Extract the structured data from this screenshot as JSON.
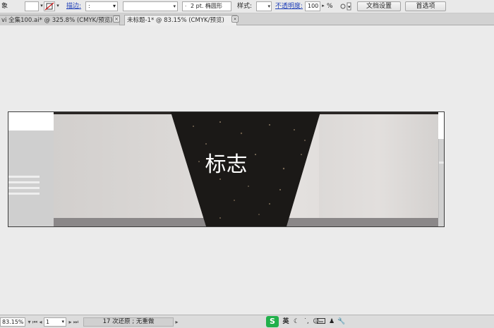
{
  "control_bar": {
    "partial_label": "象",
    "stroke_label": "描边:",
    "stroke_weight_arrow": ":",
    "brush_value": "2 pt. 椭圆形",
    "style_label": "样式:",
    "opacity_label": "不透明度:",
    "opacity_value": "100",
    "opacity_unit": "%",
    "doc_setup_button": "文档设置",
    "preferences_button": "首选项"
  },
  "tabs": [
    {
      "label": "vi 全集100.ai* @ 325.8% (CMYK/预览)",
      "active": false
    },
    {
      "label": "未标题-1* @ 83.15% (CMYK/预览)",
      "active": true
    }
  ],
  "artwork": {
    "logo_text": "标志"
  },
  "status_bar": {
    "zoom": "83.15%",
    "artboard_number": "1",
    "message": "17 次还原 ; 无重做",
    "ime_logo": "S",
    "ime_lang": "英"
  },
  "colors": {
    "panel_bg": "#e9e9e9",
    "canvas_bg": "#ebebeb",
    "link_blue": "#1f3fb8",
    "banner_dark": "#1a1816",
    "banner_light": "#dcd8d6",
    "bottom_band": "#8a8788",
    "ime_green": "#21b04b"
  }
}
